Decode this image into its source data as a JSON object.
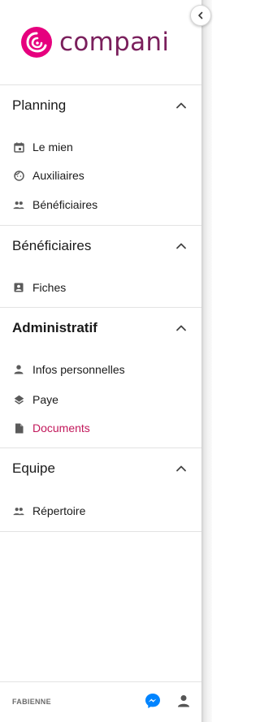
{
  "brand": {
    "name": "compani",
    "color": "#7a1f5c",
    "accent": "#e6007e"
  },
  "collapse_button": {
    "icon": "chevron-left-icon"
  },
  "sections": [
    {
      "title": "Planning",
      "bold": false,
      "expanded": true,
      "items": [
        {
          "label": "Le mien",
          "icon": "calendar-icon",
          "active": false
        },
        {
          "label": "Auxiliaires",
          "icon": "face-icon",
          "active": false
        },
        {
          "label": "Bénéficiaires",
          "icon": "people-icon",
          "active": false
        }
      ]
    },
    {
      "title": "Bénéficiaires",
      "bold": false,
      "expanded": true,
      "items": [
        {
          "label": "Fiches",
          "icon": "contact-card-icon",
          "active": false
        }
      ]
    },
    {
      "title": "Administratif",
      "bold": true,
      "expanded": true,
      "items": [
        {
          "label": "Infos personnelles",
          "icon": "person-icon",
          "active": false
        },
        {
          "label": "Paye",
          "icon": "layers-icon",
          "active": false
        },
        {
          "label": "Documents",
          "icon": "document-icon",
          "active": true
        }
      ]
    },
    {
      "title": "Equipe",
      "bold": false,
      "expanded": true,
      "items": [
        {
          "label": "Répertoire",
          "icon": "people-icon",
          "active": false
        }
      ]
    }
  ],
  "footer": {
    "user_name": "FABIENNE",
    "messenger_icon": "messenger-icon",
    "profile_icon": "person-icon"
  },
  "colors": {
    "active_item": "#c2185b",
    "icon_gray": "#5a5a5a",
    "messenger_blue": "#0084ff",
    "divider": "#e3e3e3"
  }
}
